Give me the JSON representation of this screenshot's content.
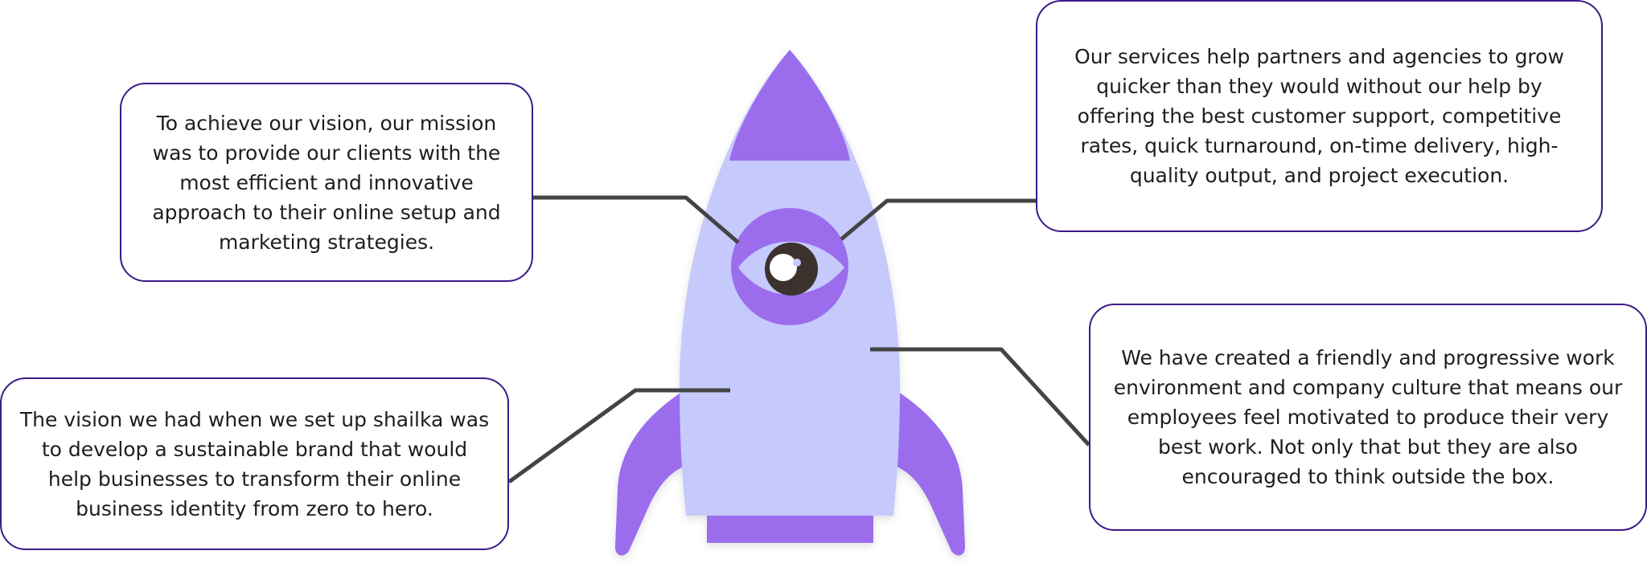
{
  "colors": {
    "rocket_body": "#c5c9fc",
    "rocket_accent": "#9b6ded",
    "eye_white": "#c5c9fc",
    "pupil": "#3a302e",
    "connector": "#444444",
    "box_border": "#3b1a87",
    "text": "#1e1e1e"
  },
  "callouts": {
    "mission": "To achieve our vision, our mission was to provide our clients with the most efficient and innovative approach to their online setup and marketing strategies.",
    "services": "Our services help partners and agencies to grow quicker than they would without our help by offering the best customer support, competitive rates, quick turnaround, on-time delivery, high-quality output, and project execution.",
    "vision": "The vision we had when we set up shailka was to develop a sustainable brand that would help businesses to transform their online business identity from zero to hero.",
    "culture": "We have created a friendly and progressive work environment and company culture that means our employees feel motivated to produce their very best work. Not only that but they are also encouraged to think outside the box."
  }
}
